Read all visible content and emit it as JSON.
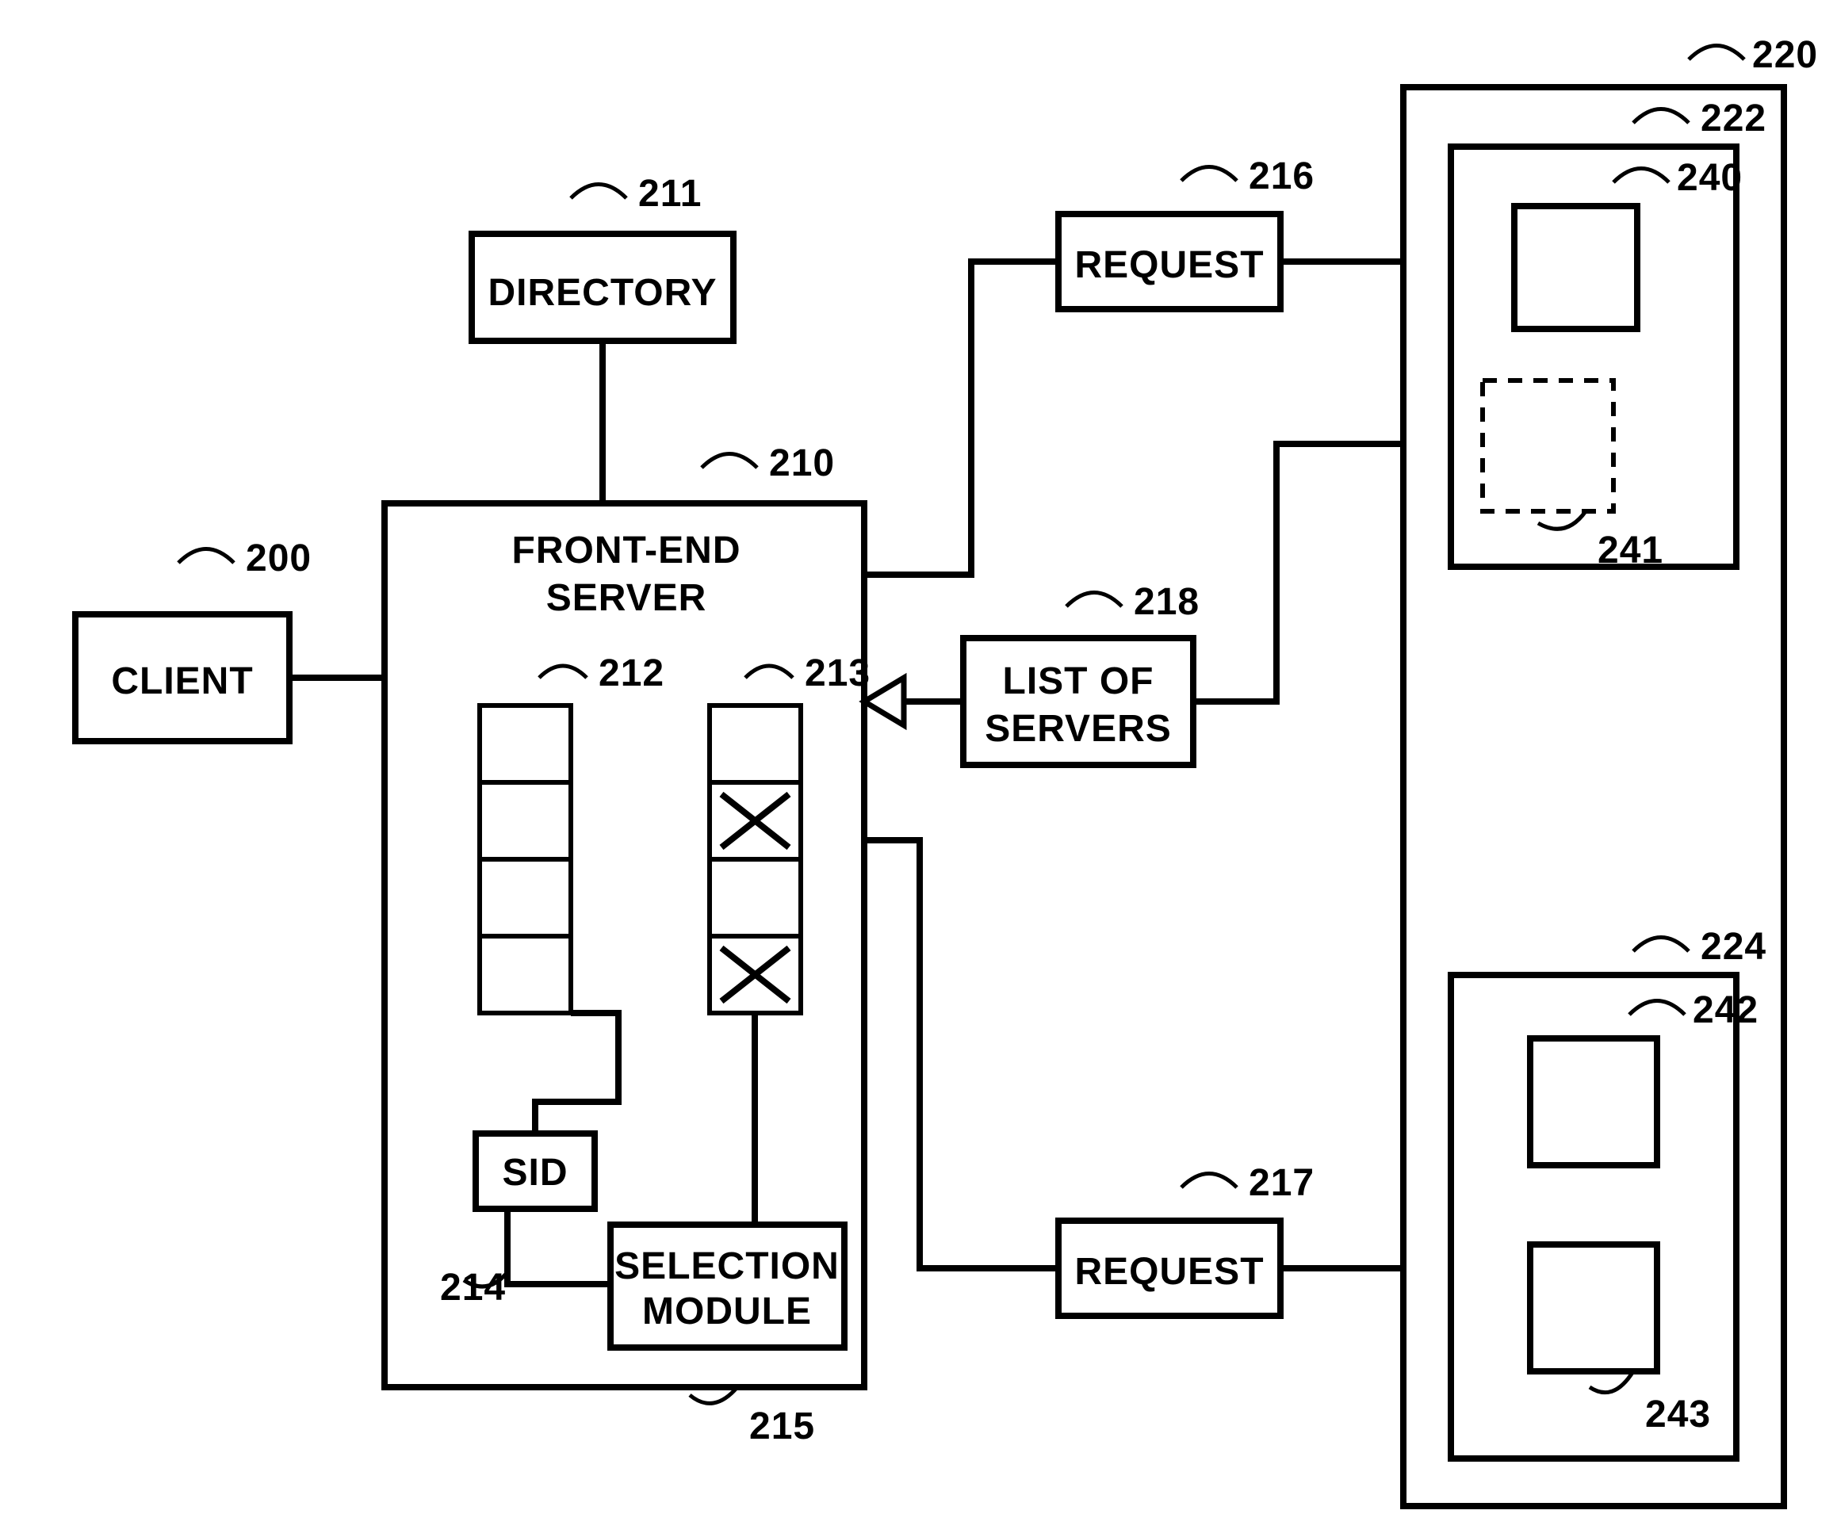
{
  "blocks": {
    "client": "CLIENT",
    "directory": "DIRECTORY",
    "frontEnd1": "FRONT-END",
    "frontEnd2": "SERVER",
    "sid": "SID",
    "selection1": "SELECTION",
    "selection2": "MODULE",
    "request216": "REQUEST",
    "request217": "REQUEST",
    "list1": "LIST OF",
    "list2": "SERVERS"
  },
  "refs": {
    "r200": "200",
    "r211": "211",
    "r210": "210",
    "r212": "212",
    "r213": "213",
    "r214": "214",
    "r215": "215",
    "r216": "216",
    "r217": "217",
    "r218": "218",
    "r220": "220",
    "r222": "222",
    "r224": "224",
    "r240": "240",
    "r241": "241",
    "r242": "242",
    "r243": "243"
  }
}
